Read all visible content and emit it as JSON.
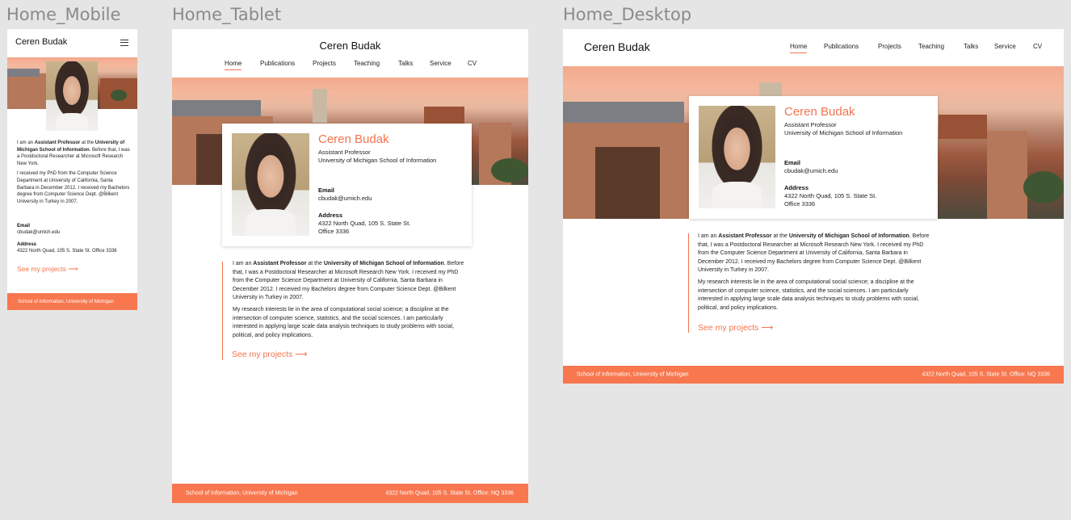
{
  "frames": {
    "mobile_label": "Home_Mobile",
    "tablet_label": "Home_Tablet",
    "desktop_label": "Home_Desktop"
  },
  "site": {
    "name": "Ceren Budak",
    "title": "Assistant Professor",
    "affiliation": "University of Michigan School of Information",
    "email_label": "Email",
    "email": "cbudak@umich.edu",
    "address_label": "Address",
    "address_line1": "4322 North Quad, 105 S. State St.",
    "address_line2": "Office 3336",
    "address_full": "4322 North Quad, 105 S. State St. Office 3336",
    "cta": "See my projects",
    "cta_arrow": "⟶"
  },
  "nav": {
    "home": "Home",
    "publications": "Publications",
    "projects": "Projects",
    "teaching": "Teaching",
    "talks": "Talks",
    "service": "Service",
    "cv": "CV"
  },
  "bio": {
    "p1_a": "I am an ",
    "p1_b": "Assistant Professor",
    "p1_c": " at the ",
    "p1_d": "University of Michigan School of  Information",
    "p1_e": ". Before that, I was a Postdoctoral Researcher at Microsoft Research New York.",
    "p1_f": " I received my PhD from the Computer Science Department at University of California, Santa Barbara in December 2012. I received my Bachelors degree from Computer Science Dept. @Bilkent University in Turkey in 2007.",
    "p2": "My research interests lie in the area of computational social science; a discipline at the intersection of computer science, statistics, and the social sciences. I am particularly interested in applying large scale data analysis techniques to study problems with social, political, and policy implications.",
    "m1_d": "University of Michigan School of  Information",
    "m1_e": ". Before that, I was a Postdoctoral Researcher at Microsoft Research New York.",
    "m2": "I received my PhD from the Computer Science Department at University of California, Santa Barbara in December 2012. I received my Bachelors degree from Computer Science Dept. @Bilkent University in Turkey in 2007."
  },
  "footer": {
    "left": "School of Information, University of Michigan",
    "right": "4322 North Quad, 105 S. State St. Office: NQ 3336"
  },
  "colors": {
    "accent": "#f4734d",
    "footer": "#f8774f",
    "canvas": "#e5e5e5"
  },
  "icons": {
    "menu": "hamburger-icon",
    "arrow": "arrow-right-icon"
  }
}
